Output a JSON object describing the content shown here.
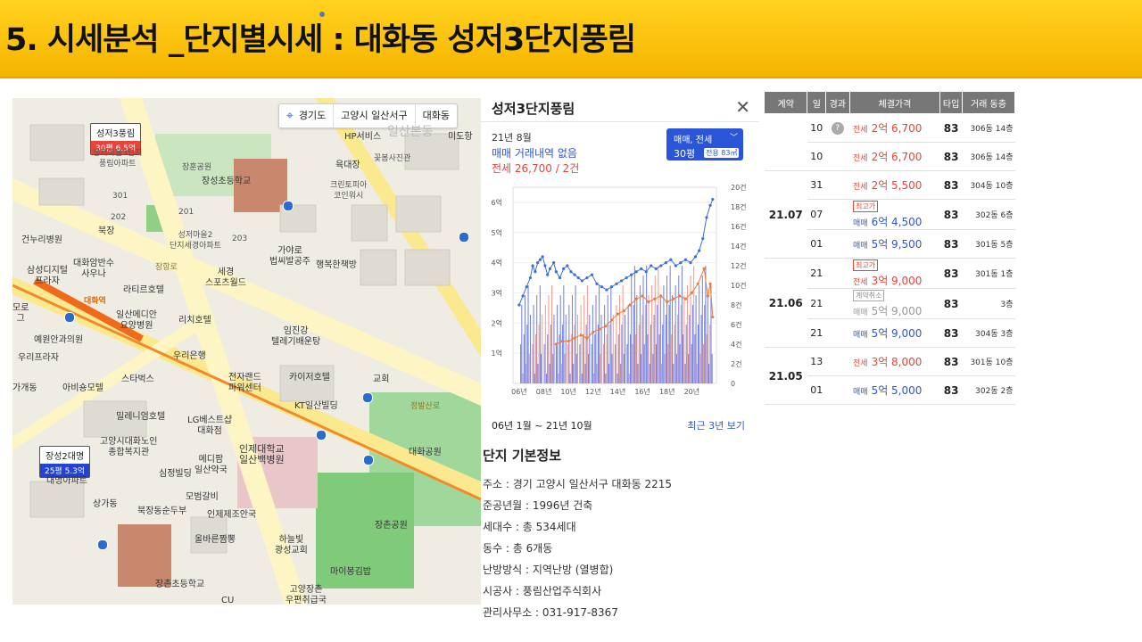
{
  "header": {
    "title": "5. 시세분석 _단지별시세 : 대화동 성저3단지풍림"
  },
  "map": {
    "breadcrumb": [
      "경기도",
      "고양시 일산서구",
      "대화동"
    ],
    "pins": [
      {
        "name": "성저3풍림",
        "price": "30평 6.5억"
      },
      {
        "name": "장성2대명",
        "price": "25평 5.3억"
      }
    ],
    "labels": {
      "hp": "HP서비스",
      "midong": "미도항",
      "ilsanbon": "일산본동",
      "janghun": "장훈공원",
      "yukdaejang": "육대장",
      "kkotbom": "꽃봄사진관",
      "crystal": "크린토피아\n코인워시",
      "seongjeo3": "성저마을3단지\n풍림아파트",
      "jangseong_school": "장성초등학교",
      "n301": "301",
      "n201": "201",
      "n202": "202",
      "n203": "203",
      "bukjang": "북장",
      "seongjeo2": "성저마을2\n단지세경아파트",
      "gayaro": "가야로\n법씨발공주",
      "happy": "행복한책방",
      "geonu": "건누리병원",
      "daehwa_pharm": "대화암반수\n사우나",
      "samsung": "삼성디지털\n프라자",
      "lateer": "라티르호텔",
      "sege": "세경\n스포츠월드",
      "moro": "모로\n그",
      "ilsan_medi": "일산메디안\n요양병원",
      "richi": "리치호텔",
      "yeyoung": "예원안과의원",
      "imjin": "임진강\n텔레기배운탕",
      "woori_bank": "우리은행",
      "urip": "우리프라자",
      "starbucks": "스타벅스",
      "jeonja": "전자랜드\n파워센터",
      "kayo": "카이저호텔",
      "gyohoe": "교회",
      "gagae": "가개동",
      "abisong": "아비숑모텔",
      "kt": "KT일산빌딩",
      "millen": "밀레니엄호텔",
      "lg": "LG베스트샵\n대화점",
      "gunja": "고양시대화노인\n종합복지관",
      "inje": "인제대학교\n일산백병원",
      "daehwa_park": "대화공원",
      "medi": "메디팜\n일산약국",
      "simjeong": "심정빌딩",
      "daemyeong": "대명아파트",
      "mobum": "모범갈비",
      "sangga": "상가동",
      "bukjang2": "북장동순두부",
      "injae2": "인제제조안국",
      "olbareun": "올바른짬뽕",
      "haneul": "하늘빛\n광성교회",
      "jangchon_park": "장촌공원",
      "jangchon_school": "장촌초등학교",
      "maibong": "마이봉김밥",
      "goyang_post": "고양장촌\n우편취급국",
      "cu": "CU",
      "daehwa_road": "대화역",
      "janghang_road": "장항로",
      "jeongbal": "정발산로"
    }
  },
  "panel": {
    "title": "성저3단지풍림",
    "month": "21년 8월",
    "sale_status": "매매 거래내역 없음",
    "lease_status": "전세 26,700 / 2건",
    "selector": {
      "type": "매매, 전세",
      "size": "30평",
      "area": "전용 83㎡"
    },
    "range": "06년 1월 ~ 21년 10월",
    "recent_link": "최근 3년 보기"
  },
  "chart_data": {
    "type": "line",
    "x_ticks": [
      "06년",
      "08년",
      "10년",
      "12년",
      "14년",
      "16년",
      "18년",
      "20년"
    ],
    "y_left_ticks": [
      "1억",
      "2억",
      "3억",
      "4억",
      "5억",
      "6억"
    ],
    "y_right_ticks": [
      "0",
      "2건",
      "4건",
      "6건",
      "8건",
      "10건",
      "12건",
      "14건",
      "16건",
      "18건",
      "20건"
    ],
    "ylim_left": [
      0,
      6.5
    ],
    "ylim_right": [
      0,
      20
    ],
    "series": [
      {
        "name": "매매",
        "color": "#3b6fe0",
        "values": [
          [
            2006.0,
            2.6
          ],
          [
            2006.3,
            2.9
          ],
          [
            2006.6,
            3.2
          ],
          [
            2006.9,
            3.5
          ],
          [
            2007.1,
            3.9
          ],
          [
            2007.3,
            3.7
          ],
          [
            2007.5,
            4.0
          ],
          [
            2007.7,
            4.1
          ],
          [
            2007.9,
            4.2
          ],
          [
            2008.1,
            3.9
          ],
          [
            2008.3,
            3.6
          ],
          [
            2008.5,
            3.8
          ],
          [
            2008.8,
            4.0
          ],
          [
            2009.0,
            3.7
          ],
          [
            2009.3,
            3.5
          ],
          [
            2009.6,
            3.8
          ],
          [
            2009.9,
            3.9
          ],
          [
            2010.2,
            3.7
          ],
          [
            2010.5,
            3.6
          ],
          [
            2010.8,
            3.5
          ],
          [
            2011.1,
            3.4
          ],
          [
            2011.5,
            3.5
          ],
          [
            2011.9,
            3.6
          ],
          [
            2012.3,
            3.3
          ],
          [
            2012.7,
            3.2
          ],
          [
            2013.1,
            3.1
          ],
          [
            2013.5,
            3.2
          ],
          [
            2013.9,
            3.3
          ],
          [
            2014.3,
            3.4
          ],
          [
            2014.7,
            3.5
          ],
          [
            2015.1,
            3.6
          ],
          [
            2015.5,
            3.7
          ],
          [
            2015.9,
            3.8
          ],
          [
            2016.3,
            3.7
          ],
          [
            2016.7,
            3.9
          ],
          [
            2017.1,
            3.8
          ],
          [
            2017.5,
            3.9
          ],
          [
            2017.9,
            4.0
          ],
          [
            2018.3,
            4.1
          ],
          [
            2018.7,
            3.9
          ],
          [
            2019.1,
            4.0
          ],
          [
            2019.5,
            4.1
          ],
          [
            2019.9,
            4.0
          ],
          [
            2020.3,
            4.2
          ],
          [
            2020.6,
            4.4
          ],
          [
            2020.9,
            4.8
          ],
          [
            2021.2,
            5.5
          ],
          [
            2021.5,
            5.9
          ],
          [
            2021.7,
            6.1
          ]
        ]
      },
      {
        "name": "전세",
        "color": "#f07a3a",
        "values": [
          [
            2009.0,
            1.3
          ],
          [
            2009.5,
            1.4
          ],
          [
            2010.0,
            1.4
          ],
          [
            2010.5,
            1.5
          ],
          [
            2011.0,
            1.6
          ],
          [
            2011.5,
            1.5
          ],
          [
            2012.0,
            1.7
          ],
          [
            2012.5,
            1.8
          ],
          [
            2013.0,
            1.9
          ],
          [
            2013.5,
            2.1
          ],
          [
            2014.0,
            2.3
          ],
          [
            2014.5,
            2.4
          ],
          [
            2015.0,
            2.6
          ],
          [
            2015.5,
            2.8
          ],
          [
            2016.0,
            2.9
          ],
          [
            2016.5,
            2.7
          ],
          [
            2017.0,
            2.8
          ],
          [
            2017.5,
            2.9
          ],
          [
            2018.0,
            2.7
          ],
          [
            2018.5,
            2.8
          ],
          [
            2019.0,
            2.9
          ],
          [
            2019.5,
            2.8
          ],
          [
            2020.0,
            3.0
          ],
          [
            2020.5,
            3.3
          ],
          [
            2021.0,
            3.8
          ],
          [
            2021.3,
            2.9
          ],
          [
            2021.5,
            3.3
          ],
          [
            2021.7,
            2.2
          ]
        ]
      }
    ]
  },
  "info": {
    "title": "단지 기본정보",
    "rows": [
      "주소 : 경기 고양시 일산서구 대화동 2215",
      "준공년월 : 1996년 건축",
      "세대수 : 총 534세대",
      "동수 : 총 6개동",
      "난방방식 : 지역난방 (열병합)",
      "시공사 : 풍림산업주식회사",
      "관리사무소 : 031-917-8367"
    ]
  },
  "table": {
    "headers": [
      "계약",
      "일",
      "경과",
      "체결가격",
      "타입",
      "거래 동층"
    ],
    "rows": [
      {
        "month": "",
        "day": "10",
        "badge": "?",
        "tag": "",
        "kind": "전세",
        "price": "2억 6,700",
        "cls": "lease",
        "type": "83",
        "floor": "306동 14층"
      },
      {
        "month": "",
        "day": "10",
        "badge": "",
        "tag": "",
        "kind": "전세",
        "price": "2억 6,700",
        "cls": "lease",
        "type": "83",
        "floor": "306동 14층"
      },
      {
        "month": "21.07",
        "day": "31",
        "badge": "",
        "tag": "",
        "kind": "전세",
        "price": "2억 5,500",
        "cls": "lease",
        "type": "83",
        "floor": "304동 10층"
      },
      {
        "month": "",
        "day": "07",
        "badge": "",
        "tag": "최고가",
        "kind": "매매",
        "price": "6억 4,500",
        "cls": "sale",
        "type": "83",
        "floor": "302동 6층"
      },
      {
        "month": "",
        "day": "01",
        "badge": "",
        "tag": "",
        "kind": "매매",
        "price": "5억 9,500",
        "cls": "sale",
        "type": "83",
        "floor": "301동 5층"
      },
      {
        "month": "21.06",
        "day": "21",
        "badge": "",
        "tag": "최고가",
        "kind": "전세",
        "price": "3억 9,000",
        "cls": "lease",
        "type": "83",
        "floor": "301동 1층"
      },
      {
        "month": "",
        "day": "21",
        "badge": "",
        "tag": "계약취소",
        "kind": "매매",
        "price": "5억 9,000",
        "cls": "cancel",
        "type": "83",
        "floor": "3층"
      },
      {
        "month": "",
        "day": "21",
        "badge": "",
        "tag": "",
        "kind": "매매",
        "price": "5억 9,000",
        "cls": "sale",
        "type": "83",
        "floor": "304동 3층"
      },
      {
        "month": "21.05",
        "day": "13",
        "badge": "",
        "tag": "",
        "kind": "전세",
        "price": "3억 8,000",
        "cls": "lease",
        "type": "83",
        "floor": "301동 10층"
      },
      {
        "month": "",
        "day": "01",
        "badge": "",
        "tag": "",
        "kind": "매매",
        "price": "5억 5,000",
        "cls": "sale",
        "type": "83",
        "floor": "302동 2층"
      }
    ]
  }
}
